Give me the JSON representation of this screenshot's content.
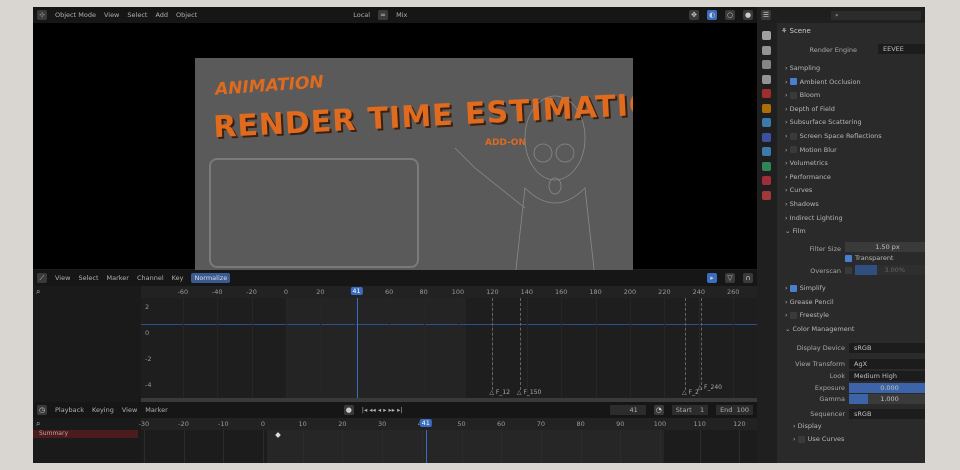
{
  "viewport_header": {
    "mode": "Object Mode",
    "menus": [
      "View",
      "Select",
      "Add",
      "Object"
    ],
    "pivot": "Local",
    "shading": "Mix"
  },
  "render_image": {
    "line1": "ANIMATION",
    "line2": "RENDER TIME ESTIMATION",
    "line3": "ADD-ON"
  },
  "graph_editor": {
    "menus": [
      "View",
      "Select",
      "Marker",
      "Channel",
      "Key"
    ],
    "normalize": "Normalize",
    "ruler": [
      "-60",
      "-40",
      "-20",
      "0",
      "20",
      "40",
      "60",
      "80",
      "100",
      "120",
      "140",
      "160",
      "180",
      "200",
      "220",
      "240",
      "260"
    ],
    "current_frame": "41",
    "y_labels": [
      "2",
      "0",
      "-2",
      "-4"
    ],
    "markers": [
      {
        "label": "F_12",
        "frame": 120
      },
      {
        "label": "F_150",
        "frame": 136
      },
      {
        "label": "F_2",
        "frame": 232
      },
      {
        "label": "F_240",
        "frame": 241
      }
    ]
  },
  "timeline": {
    "menus": [
      "Playback",
      "Keying",
      "View",
      "Marker"
    ],
    "current_frame": "41",
    "start_label": "Start",
    "start": "1",
    "end_label": "End",
    "end": "100",
    "ruler": [
      "-30",
      "-20",
      "-10",
      "0",
      "10",
      "20",
      "30",
      "40",
      "50",
      "60",
      "70",
      "80",
      "90",
      "100",
      "110",
      "120"
    ],
    "channel": "Summary"
  },
  "properties": {
    "context": "Scene",
    "render_engine_label": "Render Engine",
    "render_engine": "EEVEE",
    "panels": [
      {
        "label": "Sampling"
      },
      {
        "label": "Ambient Occlusion",
        "check": true
      },
      {
        "label": "Bloom",
        "check": false
      },
      {
        "label": "Depth of Field"
      },
      {
        "label": "Subsurface Scattering"
      },
      {
        "label": "Screen Space Reflections",
        "check": false
      },
      {
        "label": "Motion Blur",
        "check": false
      },
      {
        "label": "Volumetrics"
      },
      {
        "label": "Performance"
      },
      {
        "label": "Curves"
      },
      {
        "label": "Shadows"
      },
      {
        "label": "Indirect Lighting"
      },
      {
        "label": "Film",
        "open": true
      }
    ],
    "film": {
      "filter_size_label": "Filter Size",
      "filter_size": "1.50 px",
      "transparent": "Transparent",
      "overscan_label": "Overscan",
      "overscan": "3.00%"
    },
    "panels2": [
      {
        "label": "Simplify",
        "check": true
      },
      {
        "label": "Grease Pencil"
      },
      {
        "label": "Freestyle",
        "check": false
      },
      {
        "label": "Color Management",
        "open": true
      }
    ],
    "color": {
      "display_device_label": "Display Device",
      "display_device": "sRGB",
      "view_transform_label": "View Transform",
      "view_transform": "AgX",
      "look_label": "Look",
      "look": "Medium High Contrast",
      "exposure_label": "Exposure",
      "exposure": "0.000",
      "gamma_label": "Gamma",
      "gamma": "1.000",
      "sequencer_label": "Sequencer",
      "sequencer": "sRGB",
      "display": "Display",
      "use_curves": "Use Curves"
    }
  }
}
